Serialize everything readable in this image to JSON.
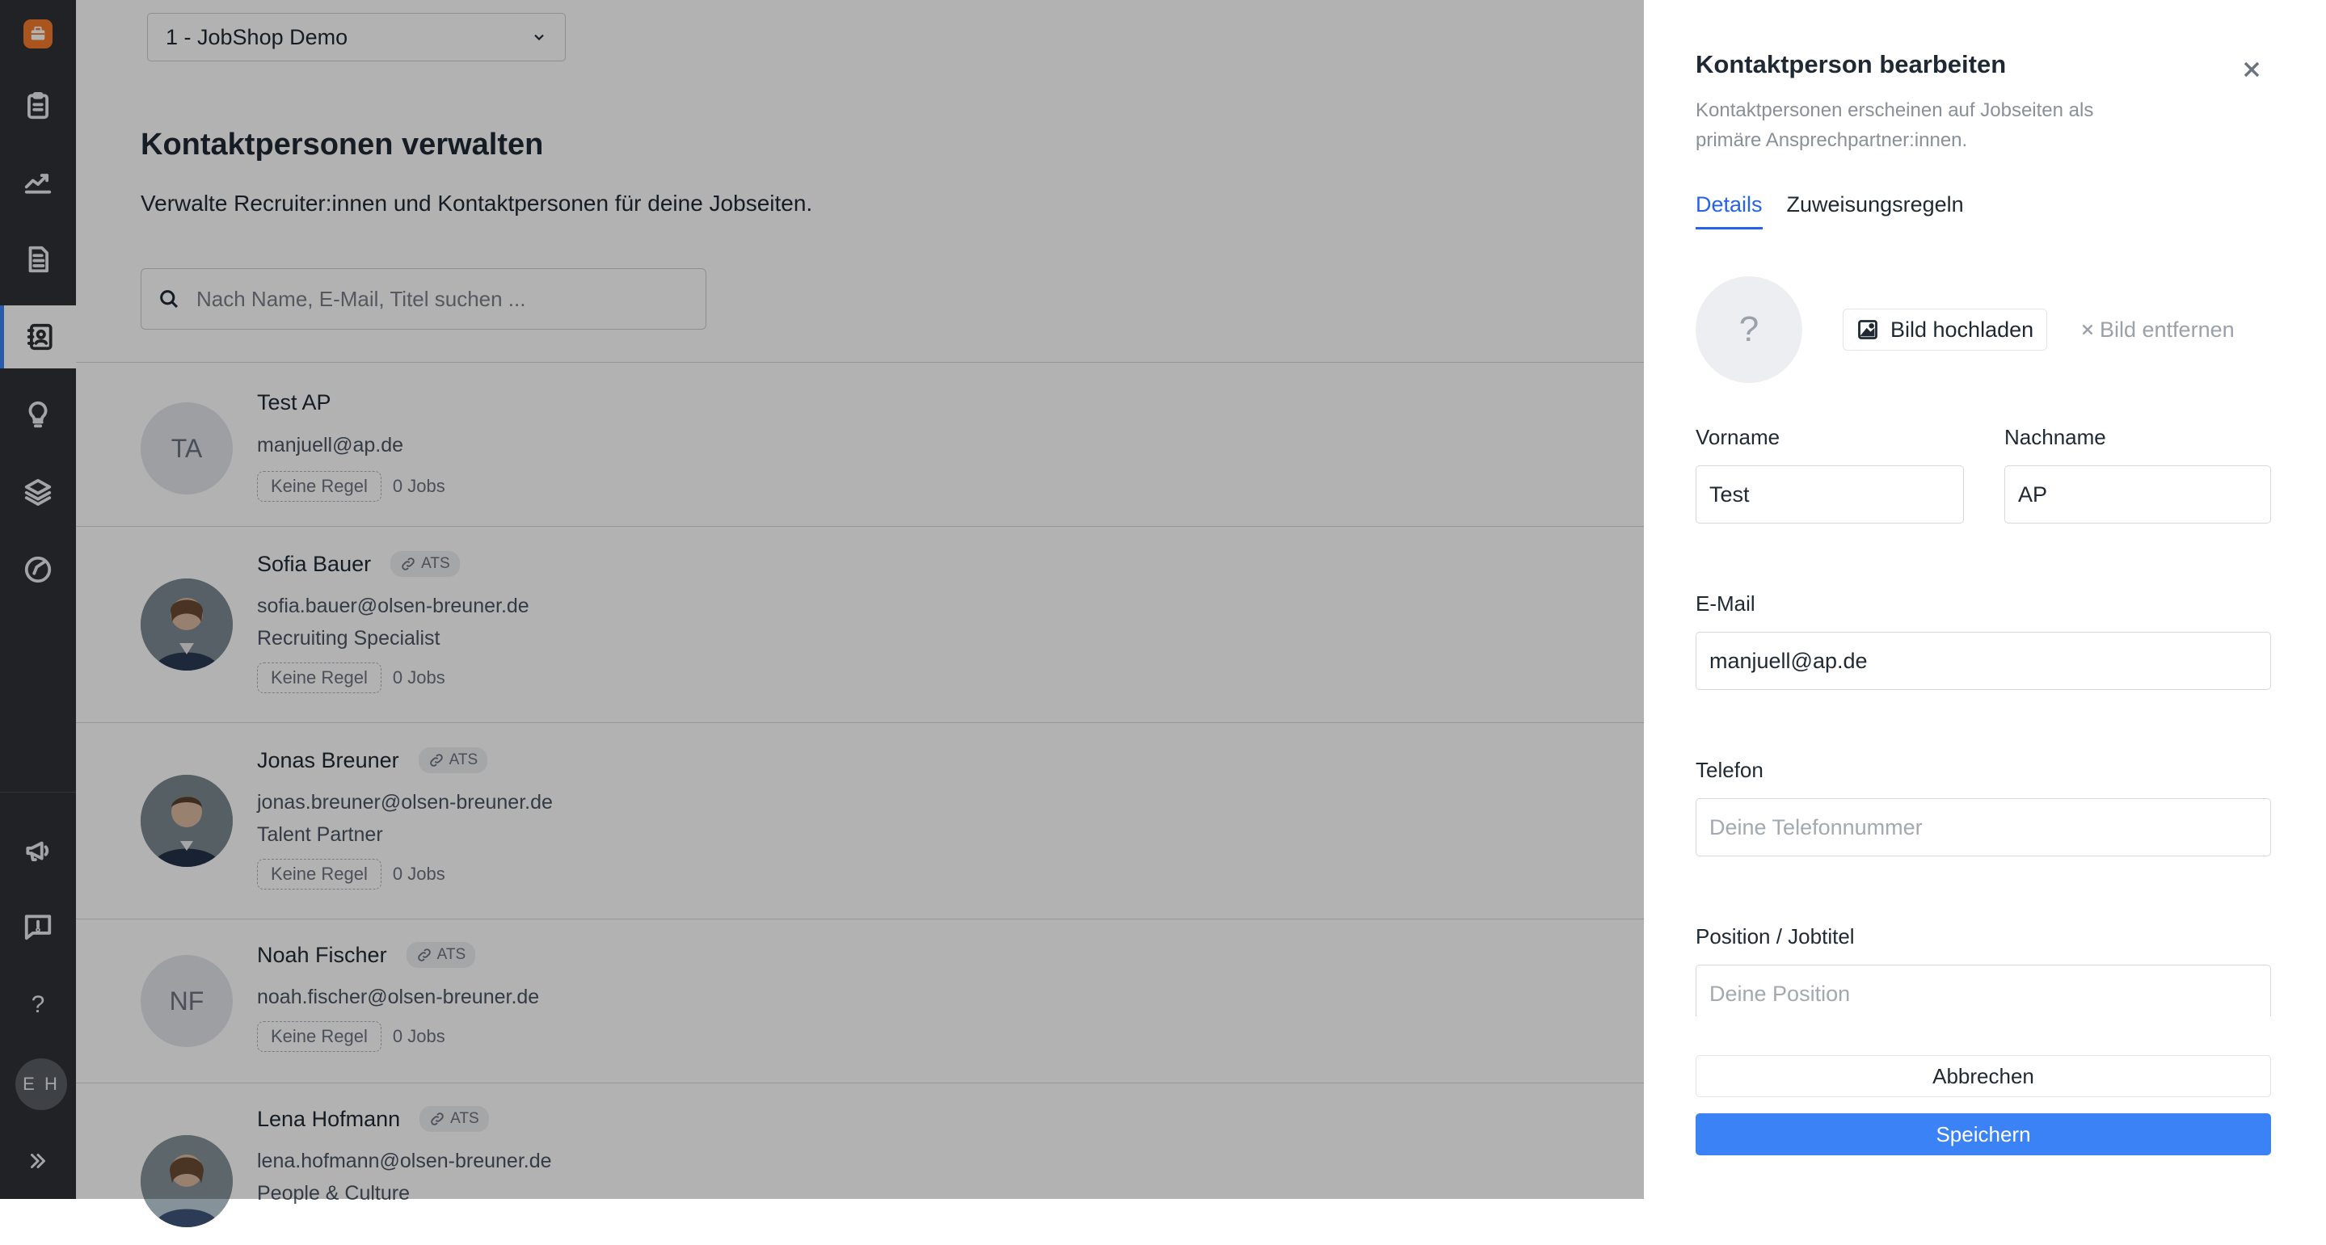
{
  "sidebar": {
    "items": [
      {
        "icon": "clipboard-icon"
      },
      {
        "icon": "chart-line-icon"
      },
      {
        "icon": "document-icon"
      },
      {
        "icon": "contacts-icon",
        "active": true
      },
      {
        "icon": "lightbulb-icon"
      },
      {
        "icon": "layers-icon"
      },
      {
        "icon": "compass-icon"
      },
      {
        "icon": "megaphone-icon"
      },
      {
        "icon": "feedback-icon"
      }
    ],
    "help": "?",
    "user_initials": "E H"
  },
  "workspace_selector": {
    "value": "1 - JobShop Demo"
  },
  "page": {
    "title": "Kontaktpersonen verwalten",
    "subtitle": "Verwalte Recruiter:innen und Kontaktpersonen für deine Jobseiten.",
    "search_placeholder": "Nach Name, E-Mail, Titel suchen ..."
  },
  "contacts": [
    {
      "initials": "TA",
      "name": "Test AP",
      "email": "manjuell@ap.de",
      "title": "",
      "ats": "",
      "rule": "Keine Regel",
      "jobs": "0 Jobs"
    },
    {
      "initials": "",
      "name": "Sofia Bauer",
      "email": "sofia.bauer@olsen-breuner.de",
      "title": "Recruiting Specialist",
      "ats": "ATS",
      "rule": "Keine Regel",
      "jobs": "0 Jobs"
    },
    {
      "initials": "",
      "name": "Jonas Breuner",
      "email": "jonas.breuner@olsen-breuner.de",
      "title": "Talent Partner",
      "ats": "ATS",
      "rule": "Keine Regel",
      "jobs": "0 Jobs"
    },
    {
      "initials": "NF",
      "name": "Noah Fischer",
      "email": "noah.fischer@olsen-breuner.de",
      "title": "",
      "ats": "ATS",
      "rule": "Keine Regel",
      "jobs": "0 Jobs"
    },
    {
      "initials": "",
      "name": "Lena Hofmann",
      "email": "lena.hofmann@olsen-breuner.de",
      "title": "People & Culture",
      "ats": "ATS",
      "rule": "",
      "jobs": ""
    }
  ],
  "drawer": {
    "title": "Kontaktperson bearbeiten",
    "description": "Kontaktpersonen erscheinen auf Jobseiten als primäre Ansprechpartner:innen.",
    "tabs": [
      {
        "label": "Details",
        "active": true
      },
      {
        "label": "Zuweisungsregeln",
        "active": false
      }
    ],
    "image_placeholder": "?",
    "upload_label": "Bild hochladen",
    "remove_label": "Bild entfernen",
    "fields": {
      "vorname": {
        "label": "Vorname",
        "value": "Test"
      },
      "nachname": {
        "label": "Nachname",
        "value": "AP"
      },
      "email": {
        "label": "E-Mail",
        "value": "manjuell@ap.de"
      },
      "telefon": {
        "label": "Telefon",
        "value": "",
        "placeholder": "Deine Telefonnummer"
      },
      "position": {
        "label": "Position / Jobtitel",
        "value": "",
        "placeholder": "Deine Position"
      }
    },
    "cancel_label": "Abbrechen",
    "save_label": "Speichern"
  },
  "colors": {
    "sidebar_bg": "#2f3135",
    "accent": "#3b82f6",
    "logo": "#f27a2a",
    "overlay": "rgba(0,0,0,0.30)"
  }
}
